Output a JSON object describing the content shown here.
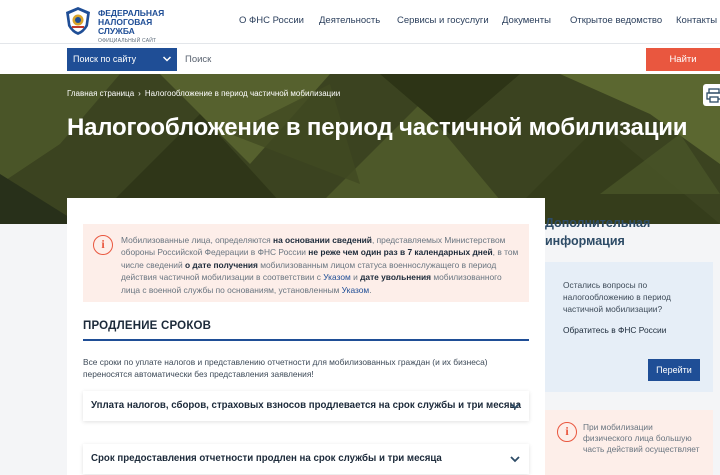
{
  "header": {
    "brand_name": "ФЕДЕРАЛЬНАЯ НАЛОГОВАЯ СЛУЖБА",
    "brand_sub": "ОФИЦИАЛЬНЫЙ САЙТ",
    "nav": [
      "О ФНС России",
      "Деятельность",
      "Сервисы и госуслуги",
      "Документы",
      "Открытое ведомство",
      "Контакты"
    ]
  },
  "search": {
    "scope": "Поиск по сайту",
    "placeholder": "Поиск",
    "button": "Найти"
  },
  "breadcrumb": [
    "Главная страница",
    "Налогообложение в период частичной мобилизации"
  ],
  "page_title": "Налогообложение в период частичной мобилизации",
  "notice": {
    "icon": "info-icon",
    "parts": [
      "Мобилизованные лица, определяются ",
      "на основании сведений",
      ", представляемых Министерством обороны Российской Федерации в ФНС России ",
      "не реже чем один раз в 7 календарных дней",
      ", в том числе сведений ",
      "о дате получения",
      " мобилизованным лицом статуса военнослужащего в период действия частичной мобилизации в соответствии с ",
      "Указом",
      " и ",
      "дате увольнения",
      " мобилизованного лица с военной службы по основаниям, установленным ",
      "Указом",
      "."
    ]
  },
  "section": {
    "title": "ПРОДЛЕНИЕ СРОКОВ",
    "intro": "Все сроки по уплате налогов и представлению отчетности для мобилизованных граждан (и их бизнеса) переносятся автоматически без представления заявления!",
    "accordion": [
      "Уплата налогов, сборов, страховых взносов продлевается на срок службы и три месяца",
      "Срок предоставления отчетности продлен на срок службы и три месяца"
    ]
  },
  "sidebar": {
    "title": "Дополнительная информация",
    "question": "Остались вопросы по налогообложению в период частичной мобилизации?",
    "contact": "Обратитесь в ФНС России",
    "button": "Перейти",
    "note": "При мобилизации физического лица большую часть действий осуществляет"
  },
  "colors": {
    "brand_blue": "#1f4e96",
    "accent_orange": "#e9573f",
    "notice_bg": "#fdeee9",
    "sidebar_card_bg": "#e6eef7"
  }
}
